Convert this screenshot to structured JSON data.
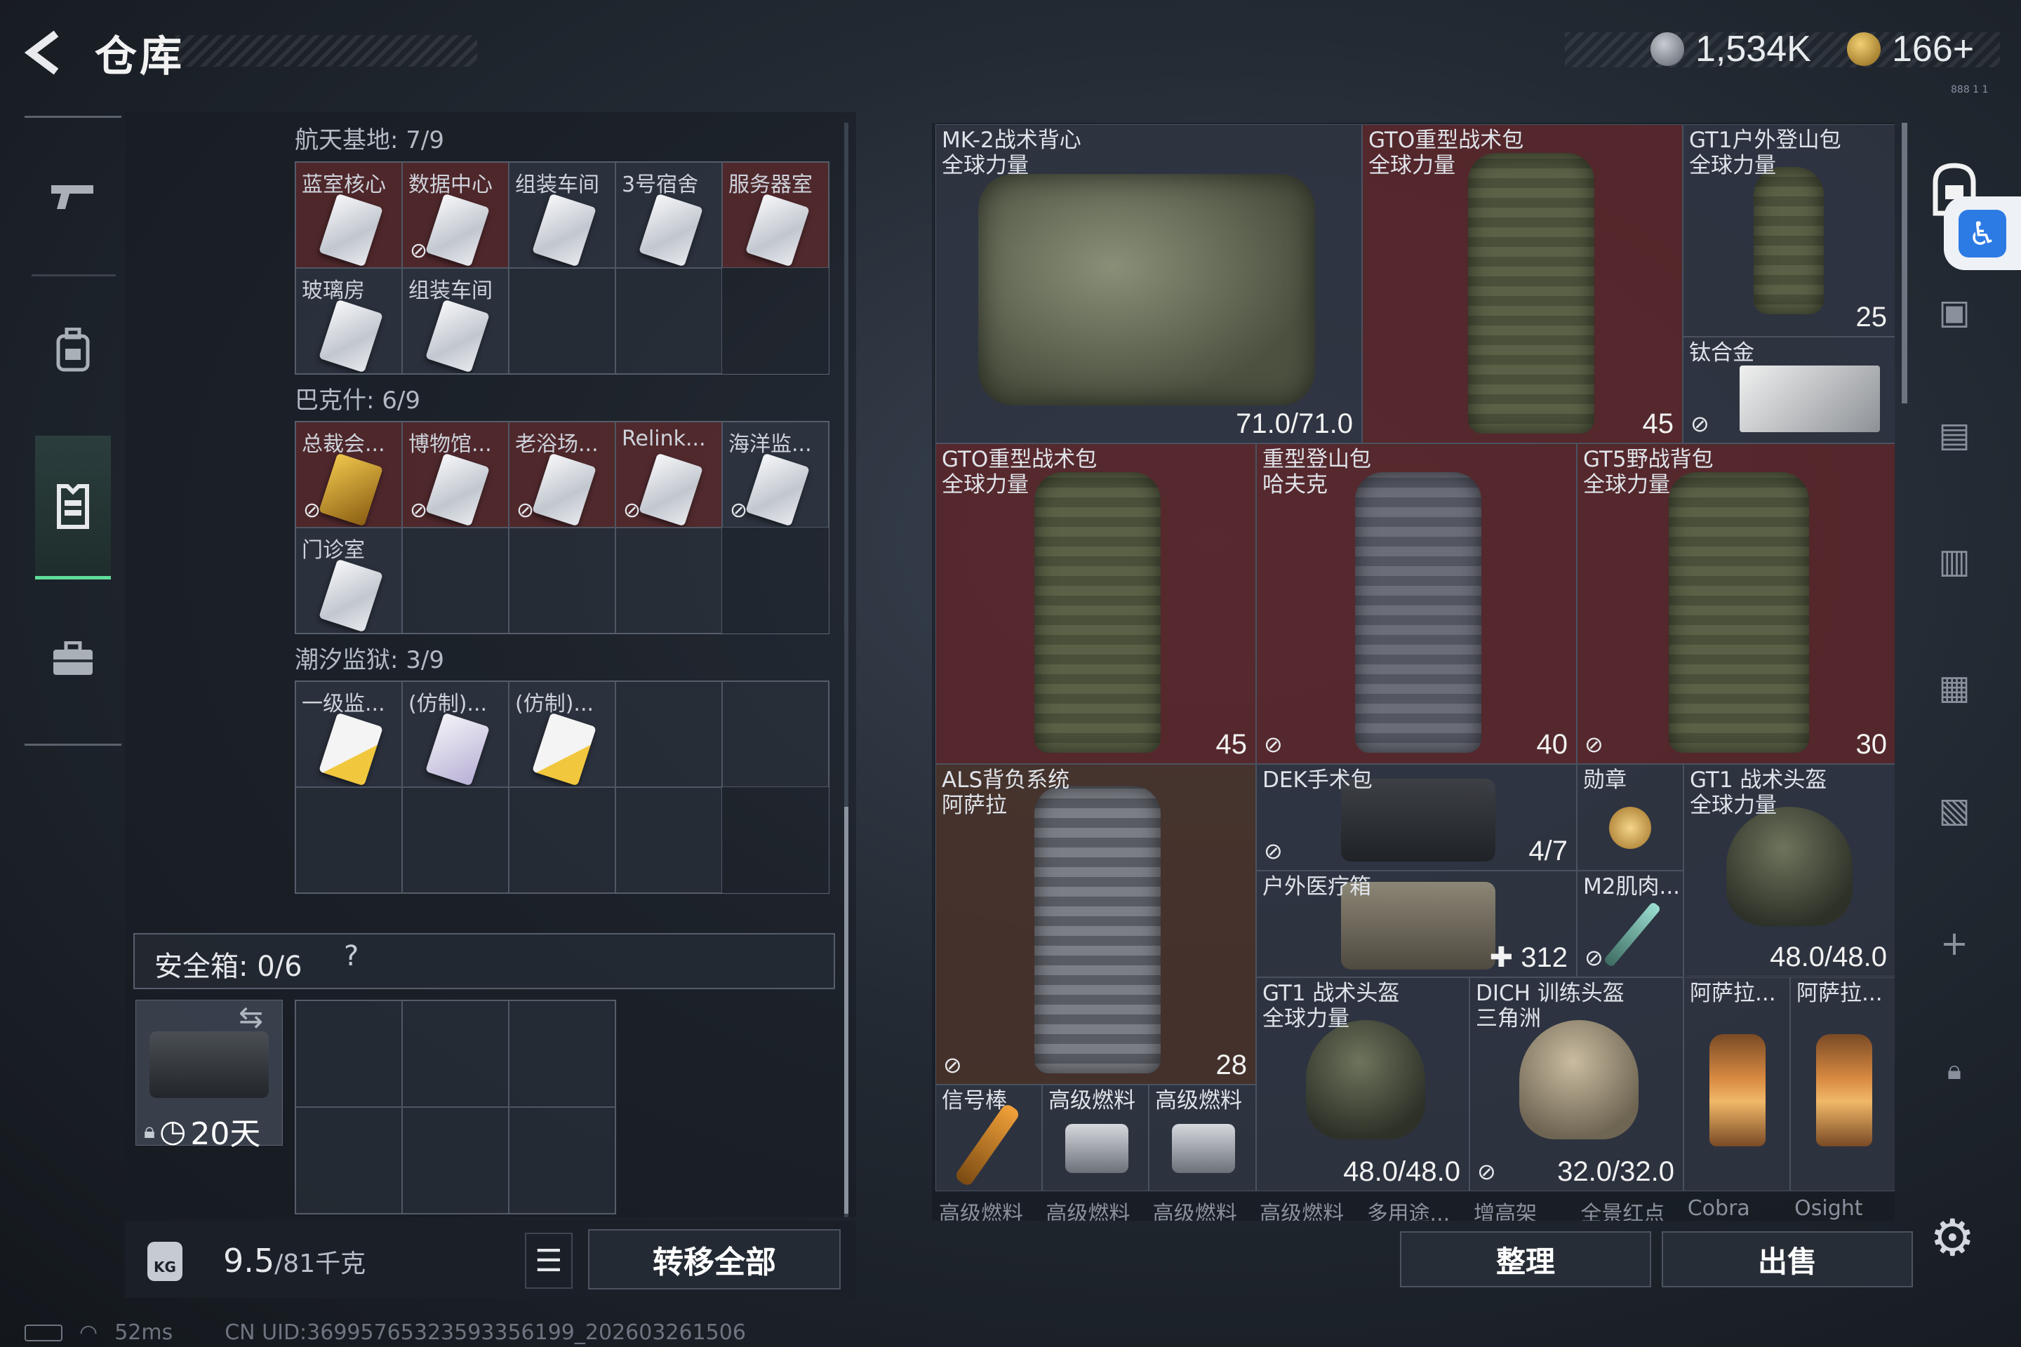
{
  "header": {
    "title": "仓库",
    "currency1": "1,534K",
    "currency2": "166+",
    "tiny": "888 1 1"
  },
  "nav": [
    {
      "name": "weapons-tab",
      "icon": "gun-icon"
    },
    {
      "name": "backpack-tab",
      "icon": "backpack-icon"
    },
    {
      "name": "armor-tab",
      "icon": "vest-icon",
      "active": true
    },
    {
      "name": "toolbox-tab",
      "icon": "toolbox-icon"
    }
  ],
  "sections": [
    {
      "title": "航天基地: 7/9",
      "cells": [
        "蓝室核心",
        "数据中心",
        "组装车间",
        "3号宿舍",
        "服务器室",
        "玻璃房",
        "组装车间",
        "",
        ""
      ]
    },
    {
      "title": "巴克什: 6/9",
      "cells": [
        "总裁会...",
        "博物馆...",
        "老浴场...",
        "Relink...",
        "海洋监...",
        "门诊室",
        "",
        "",
        ""
      ]
    },
    {
      "title": "潮汐监狱: 3/9",
      "cells": [
        "一级监...",
        "(仿制)...",
        "(仿制)...",
        "",
        "",
        "",
        "",
        "",
        ""
      ]
    }
  ],
  "safe": {
    "label": "安全箱: 0/6",
    "help": "?",
    "time": "20天"
  },
  "footer_left": {
    "weight": "9.5",
    "weight_max": "/81千克",
    "kg": "KG",
    "transfer": "转移全部"
  },
  "status": {
    "ping": "52ms",
    "uid": "CN UID:3699576532359335​6199_202603261506"
  },
  "items": [
    {
      "name": "MK-2战术背心\n全球力量",
      "qty": "71.0/71.0"
    },
    {
      "name": "GTO重型战术包\n全球力量",
      "qty": "45"
    },
    {
      "name": "GT1户外登山包\n全球力量",
      "qty": "25"
    },
    {
      "name": "钛合金",
      "qty": ""
    },
    {
      "name": "GTO重型战术包\n全球力量",
      "qty": "45"
    },
    {
      "name": "重型登山包\n哈夫克",
      "qty": "40"
    },
    {
      "name": "GT5野战背包\n全球力量",
      "qty": "30"
    },
    {
      "name": "ALS背负系统\n阿萨拉",
      "qty": "28"
    },
    {
      "name": "DEK手术包",
      "qty": "4/7"
    },
    {
      "name": "勋章",
      "qty": ""
    },
    {
      "name": "GT1 战术头盔\n全球力量",
      "qty": "48.0/48.0"
    },
    {
      "name": "户外医疗箱",
      "qty": "312"
    },
    {
      "name": "M2肌肉...",
      "qty": ""
    },
    {
      "name": "信号棒",
      "qty": ""
    },
    {
      "name": "高级燃料",
      "qty": ""
    },
    {
      "name": "高级燃料",
      "qty": ""
    },
    {
      "name": "GT1 战术头盔\n全球力量",
      "qty": "48.0/48.0"
    },
    {
      "name": "DICH 训练头盔\n三角洲",
      "qty": "32.0/32.0"
    },
    {
      "name": "阿萨拉...",
      "qty": ""
    },
    {
      "name": "阿萨拉...",
      "qty": ""
    }
  ],
  "bottom_row": [
    "高级燃料",
    "高级燃料",
    "高级燃料",
    "高级燃料",
    "多用途...",
    "增高架",
    "全景红点",
    "Cobra",
    "Osight"
  ],
  "buttons": {
    "sort": "整理",
    "sell": "出售"
  }
}
